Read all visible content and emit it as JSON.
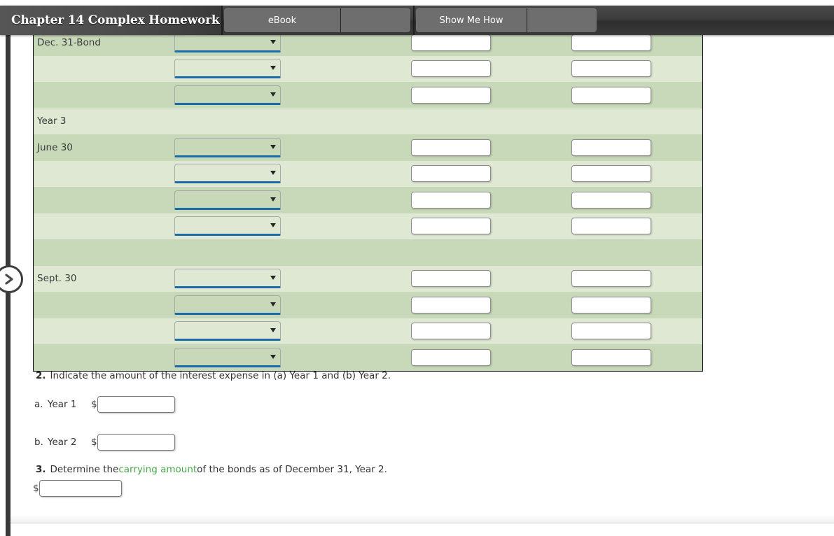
{
  "header": {
    "title": "Chapter 14 Complex Homework",
    "buttons": [
      {
        "label": "eBook",
        "name": "ebook-button"
      },
      {
        "label": "Show Me How",
        "name": "show-me-how-button"
      }
    ]
  },
  "nav": {
    "next_icon": "chevron-right-icon"
  },
  "journal": {
    "rows": [
      {
        "date": "Dec. 31-Bond",
        "shade": "dark",
        "has_select": true,
        "has_inputs": true
      },
      {
        "date": "",
        "shade": "light",
        "has_select": true,
        "has_inputs": true
      },
      {
        "date": "",
        "shade": "dark",
        "has_select": true,
        "has_inputs": true
      },
      {
        "date": "Year 3",
        "shade": "light",
        "has_select": false,
        "has_inputs": false
      },
      {
        "date": "June 30",
        "shade": "dark",
        "has_select": true,
        "has_inputs": true
      },
      {
        "date": "",
        "shade": "light",
        "has_select": true,
        "has_inputs": true
      },
      {
        "date": "",
        "shade": "dark",
        "has_select": true,
        "has_inputs": true
      },
      {
        "date": "",
        "shade": "light",
        "has_select": true,
        "has_inputs": true
      },
      {
        "date": "",
        "shade": "dark",
        "has_select": false,
        "has_inputs": false
      },
      {
        "date": "Sept. 30",
        "shade": "light",
        "has_select": true,
        "has_inputs": true
      },
      {
        "date": "",
        "shade": "dark",
        "has_select": true,
        "has_inputs": true
      },
      {
        "date": "",
        "shade": "light",
        "has_select": true,
        "has_inputs": true
      },
      {
        "date": "",
        "shade": "dark",
        "has_select": true,
        "has_inputs": true
      }
    ],
    "select_value": "",
    "input_value": ""
  },
  "questions": {
    "q2": {
      "number": "2.",
      "text": "Indicate the amount of the interest expense in (a) Year 1 and (b) Year 2.",
      "a": {
        "letter": "a.",
        "label": "Year 1",
        "currency": "$",
        "value": ""
      },
      "b": {
        "letter": "b.",
        "label": "Year 2",
        "currency": "$",
        "value": ""
      }
    },
    "q3": {
      "number": "3.",
      "text_before": "Determine the ",
      "link": "carrying amount",
      "text_after": " of the bonds as of December 31, Year 2.",
      "currency": "$",
      "value": ""
    }
  },
  "colors": {
    "row_dark": "#c7d9b8",
    "row_light": "#dfe8d2",
    "accent_underline": "#1b6ba8",
    "link_green": "#4aa64a",
    "header_bar": "#3d3d3d"
  }
}
